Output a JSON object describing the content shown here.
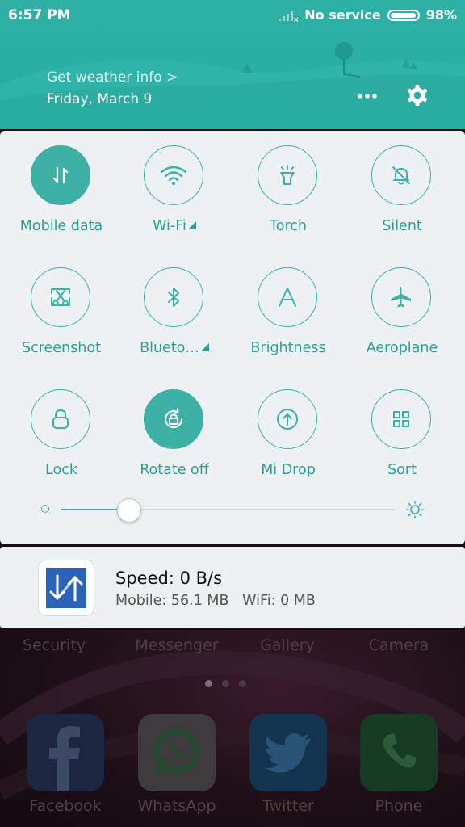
{
  "status_bar": {
    "time": "6:57 PM",
    "carrier": "No service",
    "battery": "98%"
  },
  "header": {
    "weather_link": "Get weather info >",
    "date": "Friday, March 9",
    "icons": [
      "more-icon",
      "gear-icon"
    ]
  },
  "tiles": [
    {
      "label": "Mobile data",
      "icon": "mobile-data-icon",
      "active": true
    },
    {
      "label": "Wi-Fi",
      "icon": "wifi-icon",
      "active": false,
      "expandable": true
    },
    {
      "label": "Torch",
      "icon": "torch-icon",
      "active": false
    },
    {
      "label": "Silent",
      "icon": "silent-bell-icon",
      "active": false
    },
    {
      "label": "Screenshot",
      "icon": "screenshot-scissors-icon",
      "active": false
    },
    {
      "label": "Blueto…",
      "icon": "bluetooth-icon",
      "active": false,
      "expandable": true
    },
    {
      "label": "Brightness",
      "icon": "brightness-a-icon",
      "active": false
    },
    {
      "label": "Aeroplane",
      "icon": "aeroplane-icon",
      "active": false
    },
    {
      "label": "Lock",
      "icon": "lock-icon",
      "active": false
    },
    {
      "label": "Rotate off",
      "icon": "rotate-lock-icon",
      "active": true
    },
    {
      "label": "Mi Drop",
      "icon": "mi-drop-icon",
      "active": false
    },
    {
      "label": "Sort",
      "icon": "sort-grid-icon",
      "active": false
    }
  ],
  "brightness_slider": {
    "level": 0.2
  },
  "notification": {
    "title": "Speed: 0 B/s",
    "subtitle": "Mobile: 56.1 MB   WiFi: 0 MB",
    "icon": "network-speed-icon"
  },
  "home_screen": {
    "top_row": [
      "Security",
      "Messenger",
      "Gallery",
      "Camera"
    ],
    "dock": [
      "Facebook",
      "WhatsApp",
      "Twitter",
      "Phone"
    ]
  },
  "colors": {
    "accent": "#3db1a6",
    "header": "#2fb1a6",
    "panel": "#edf1f3"
  }
}
